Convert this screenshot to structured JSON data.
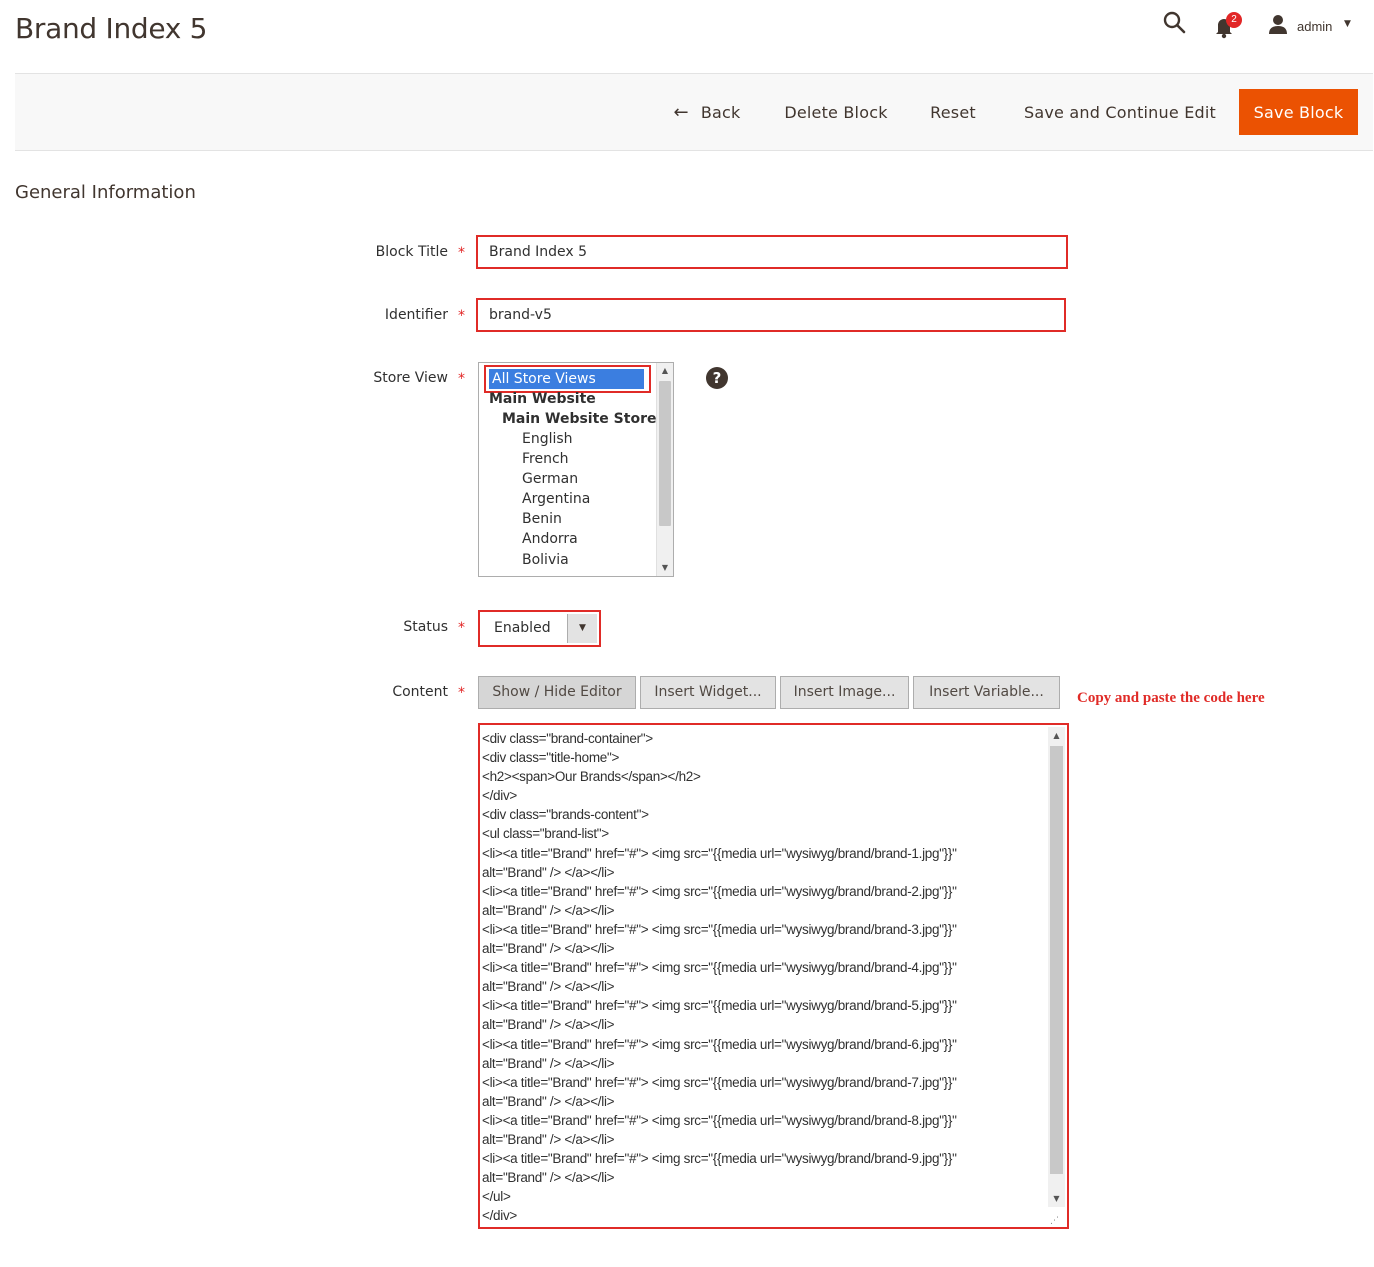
{
  "page": {
    "title": "Brand Index 5"
  },
  "header": {
    "notifications_count": "2",
    "user_name": "admin"
  },
  "toolbar": {
    "back_label": "Back",
    "delete_label": "Delete Block",
    "reset_label": "Reset",
    "save_continue_label": "Save and Continue Edit",
    "save_label": "Save Block"
  },
  "section": {
    "title": "General Information"
  },
  "form": {
    "block_title": {
      "label": "Block Title",
      "value": "Brand Index 5"
    },
    "identifier": {
      "label": "Identifier",
      "value": "brand-v5"
    },
    "store_view": {
      "label": "Store View",
      "options": [
        {
          "text": "All Store Views"
        },
        {
          "text": "Main Website"
        },
        {
          "text": "Main Website Store"
        },
        {
          "text": "English"
        },
        {
          "text": "French"
        },
        {
          "text": "German"
        },
        {
          "text": "Argentina"
        },
        {
          "text": "Benin"
        },
        {
          "text": "Andorra"
        },
        {
          "text": "Bolivia"
        }
      ]
    },
    "status": {
      "label": "Status",
      "value": "Enabled"
    },
    "content": {
      "label": "Content",
      "buttons": {
        "show_hide": "Show / Hide Editor",
        "widget": "Insert Widget...",
        "image": "Insert Image...",
        "variable": "Insert Variable..."
      },
      "annotation": "Copy and paste the code here",
      "lines": [
        "<div class=\"brand-container\">",
        "<div class=\"title-home\">",
        "<h2><span>Our Brands</span></h2>",
        "</div>",
        "<div class=\"brands-content\">",
        "<ul class=\"brand-list\">",
        "<li><a title=\"Brand\" href=\"#\"> <img src=\"{{media url=\"wysiwyg/brand/brand-1.jpg\"}}\"",
        "alt=\"Brand\" /> </a></li>",
        "<li><a title=\"Brand\" href=\"#\"> <img src=\"{{media url=\"wysiwyg/brand/brand-2.jpg\"}}\"",
        "alt=\"Brand\" /> </a></li>",
        "<li><a title=\"Brand\" href=\"#\"> <img src=\"{{media url=\"wysiwyg/brand/brand-3.jpg\"}}\"",
        "alt=\"Brand\" /> </a></li>",
        "<li><a title=\"Brand\" href=\"#\"> <img src=\"{{media url=\"wysiwyg/brand/brand-4.jpg\"}}\"",
        "alt=\"Brand\" /> </a></li>",
        "<li><a title=\"Brand\" href=\"#\"> <img src=\"{{media url=\"wysiwyg/brand/brand-5.jpg\"}}\"",
        "alt=\"Brand\" /> </a></li>",
        "<li><a title=\"Brand\" href=\"#\"> <img src=\"{{media url=\"wysiwyg/brand/brand-6.jpg\"}}\"",
        "alt=\"Brand\" /> </a></li>",
        "<li><a title=\"Brand\" href=\"#\"> <img src=\"{{media url=\"wysiwyg/brand/brand-7.jpg\"}}\"",
        "alt=\"Brand\" /> </a></li>",
        "<li><a title=\"Brand\" href=\"#\"> <img src=\"{{media url=\"wysiwyg/brand/brand-8.jpg\"}}\"",
        "alt=\"Brand\" /> </a></li>",
        "<li><a title=\"Brand\" href=\"#\"> <img src=\"{{media url=\"wysiwyg/brand/brand-9.jpg\"}}\"",
        "alt=\"Brand\" /> </a></li>",
        "</ul>",
        "</div>"
      ]
    }
  },
  "colors": {
    "accent": "#eb5202",
    "highlight": "#e02b27",
    "selection": "#3b7ee0"
  }
}
